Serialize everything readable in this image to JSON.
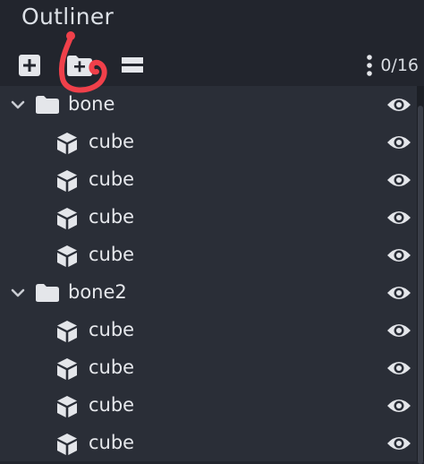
{
  "panel": {
    "title": "Outliner"
  },
  "toolbar": {
    "add_cube_icon": "plus-box-icon",
    "add_group_icon": "folder-plus-icon",
    "collapse_icon": "collapse-all-icon",
    "menu_icon": "vertical-dots-icon",
    "counter": "0/16"
  },
  "colors": {
    "background": "#23262e",
    "list_background": "#2a2e37",
    "text": "#e6e8ec",
    "annotation": "#f0404a"
  },
  "tree": [
    {
      "label": "bone",
      "children": [
        "cube",
        "cube",
        "cube",
        "cube"
      ]
    },
    {
      "label": "bone2",
      "children": [
        "cube",
        "cube",
        "cube",
        "cube"
      ]
    }
  ]
}
